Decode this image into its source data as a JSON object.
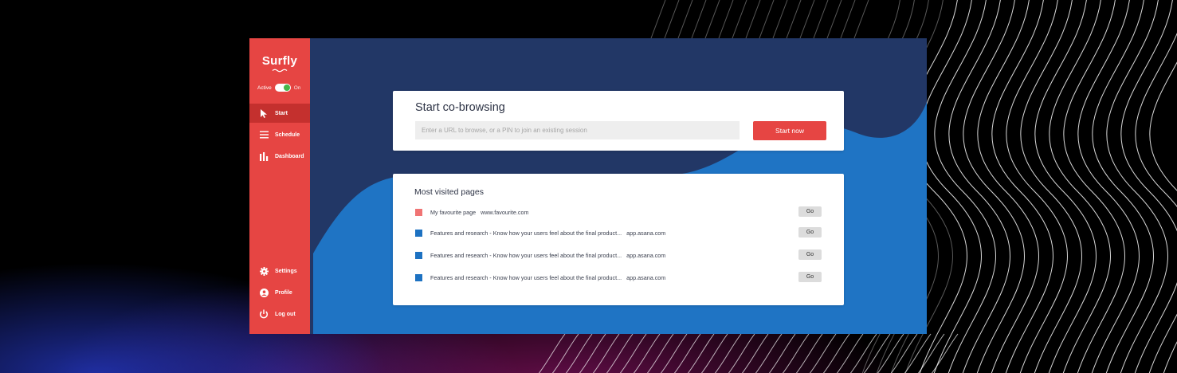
{
  "app": {
    "logo": "Surfly",
    "active_label": "Active",
    "toggle_state": "On",
    "toggle_on": true
  },
  "sidebar": {
    "top_items": [
      {
        "label": "Start",
        "icon": "cursor-icon",
        "active": true
      },
      {
        "label": "Schedule",
        "icon": "list-icon",
        "active": false
      },
      {
        "label": "Dashboard",
        "icon": "bar-chart-icon",
        "active": false
      }
    ],
    "bottom_items": [
      {
        "label": "Settings",
        "icon": "gear-icon"
      },
      {
        "label": "Profile",
        "icon": "user-icon"
      },
      {
        "label": "Log out",
        "icon": "power-icon"
      }
    ]
  },
  "start": {
    "title": "Start co-browsing",
    "input_placeholder": "Enter a URL to browse, or a PIN to join an existing session",
    "input_value": "",
    "button_label": "Start now"
  },
  "visited": {
    "title": "Most visited pages",
    "rows": [
      {
        "title": "My favourite page",
        "url": "www.favourite.com",
        "color": "#f07474",
        "go_label": "Go"
      },
      {
        "title": "Features and research - Know how your users feel about the final product...",
        "url": "app.asana.com",
        "color": "#1d72c2",
        "go_label": "Go"
      },
      {
        "title": "Features and research - Know how your users feel about the final product...",
        "url": "app.asana.com",
        "color": "#1d72c2",
        "go_label": "Go"
      },
      {
        "title": "Features and research - Know how your users feel about the final product...",
        "url": "app.asana.com",
        "color": "#1d72c2",
        "go_label": "Go"
      }
    ]
  },
  "colors": {
    "brand_red": "#e64543",
    "sidebar_active": "#c4302e",
    "app_background": "#223766",
    "wave_blue": "#1f74c4",
    "button_grey": "#dcdcdc"
  }
}
